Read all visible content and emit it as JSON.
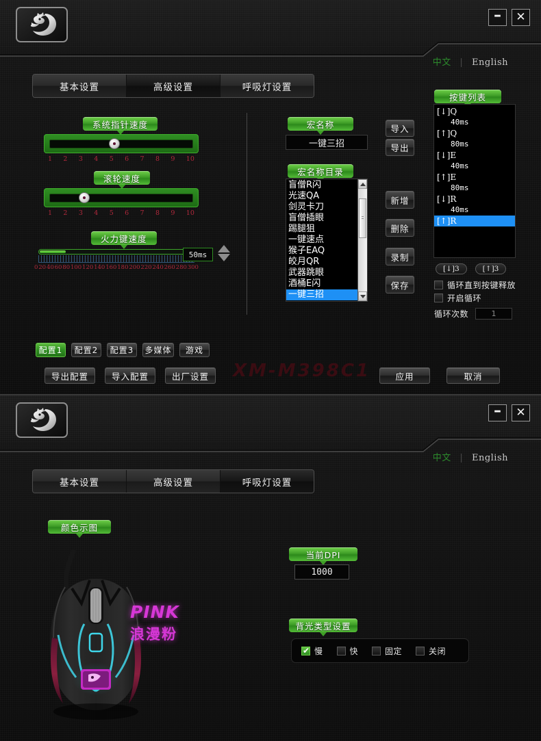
{
  "window": {
    "minimize_label": "–",
    "close_label": "✕",
    "logo_name": "dragon-logo"
  },
  "language": {
    "chinese": "中文",
    "separator": "|",
    "english": "English"
  },
  "top_panel": {
    "tabs": [
      {
        "label": "基本设置",
        "active": false
      },
      {
        "label": "高级设置",
        "active": true
      },
      {
        "label": "呼吸灯设置",
        "active": false
      }
    ],
    "pointer_speed": {
      "title": "系统指针速度",
      "ticks": [
        "1",
        "2",
        "3",
        "4",
        "5",
        "6",
        "7",
        "8",
        "9",
        "10"
      ],
      "value": 5
    },
    "wheel_speed": {
      "title": "滚轮速度",
      "ticks": [
        "1",
        "2",
        "3",
        "4",
        "5",
        "6",
        "7",
        "8",
        "9",
        "10"
      ],
      "value": 3
    },
    "fire_speed": {
      "title": "火力键速度",
      "ticks": [
        "0",
        "20",
        "40",
        "60",
        "80",
        "100",
        "120",
        "140",
        "160",
        "180",
        "200",
        "220",
        "240",
        "260",
        "280",
        "300"
      ],
      "value_label": "50ms",
      "fill_percent": 17
    },
    "macro_name": {
      "title": "宏名称",
      "value": "一键三招"
    },
    "macro_list": {
      "title": "宏名称目录",
      "items": [
        "盲僧R闪",
        "光速QA",
        "剑灵卡刀",
        "盲僧插眼",
        "踢腿狙",
        "一键速点",
        "猴子EAQ",
        "皎月QR",
        "武器跳眼",
        "酒桶E闪",
        "一键三招"
      ],
      "selected_index": 10
    },
    "side_buttons": {
      "import": "导入",
      "export": "导出",
      "add": "新增",
      "delete": "删除",
      "record": "录制",
      "save": "保存"
    },
    "key_list": {
      "title": "按键列表",
      "entries": [
        {
          "text": "[↓]Q",
          "type": "key",
          "selected": false
        },
        {
          "text": "40ms",
          "type": "delay",
          "selected": false
        },
        {
          "text": "[↑]Q",
          "type": "key",
          "selected": false
        },
        {
          "text": "80ms",
          "type": "delay",
          "selected": false
        },
        {
          "text": "[↓]E",
          "type": "key",
          "selected": false
        },
        {
          "text": "40ms",
          "type": "delay",
          "selected": false
        },
        {
          "text": "[↑]E",
          "type": "key",
          "selected": false
        },
        {
          "text": "80ms",
          "type": "delay",
          "selected": false
        },
        {
          "text": "[↓]R",
          "type": "key",
          "selected": false
        },
        {
          "text": "40ms",
          "type": "delay",
          "selected": false
        },
        {
          "text": "[↑]R",
          "type": "key",
          "selected": true
        }
      ],
      "pill_down": "[↓]3",
      "pill_up": "[↑]3",
      "loop_until_release": {
        "label": "循环直到按键释放",
        "checked": false
      },
      "enable_loop": {
        "label": "开启循环",
        "checked": false
      },
      "loop_count_label": "循环次数",
      "loop_count_value": "1"
    },
    "profiles": [
      {
        "label": "配置1",
        "active": true
      },
      {
        "label": "配置2",
        "active": false
      },
      {
        "label": "配置3",
        "active": false
      },
      {
        "label": "多媒体",
        "active": false
      },
      {
        "label": "游戏",
        "active": false
      }
    ],
    "config_buttons": [
      "导出配置",
      "导入配置",
      "出厂设置"
    ],
    "watermark": "XM-M398C1",
    "apply": "应用",
    "cancel": "取消"
  },
  "bottom_panel": {
    "tabs": [
      {
        "label": "基本设置",
        "active": false
      },
      {
        "label": "高级设置",
        "active": false
      },
      {
        "label": "呼吸灯设置",
        "active": true
      }
    ],
    "color_preview": {
      "title": "颜色示图",
      "color_name_en": "PINK",
      "color_name_cn": "浪漫粉",
      "accent_color": "#d637d6"
    },
    "dpi": {
      "title": "当前DPI",
      "value": "1000"
    },
    "backlight": {
      "title": "背光类型设置",
      "options": [
        {
          "label": "慢",
          "checked": true
        },
        {
          "label": "快",
          "checked": false
        },
        {
          "label": "固定",
          "checked": false
        },
        {
          "label": "关闭",
          "checked": false
        }
      ]
    }
  },
  "colors": {
    "green": "#2f8e22",
    "selection_blue": "#1e90f5",
    "tick_red": "#b2293c",
    "pink": "#d637d6"
  }
}
